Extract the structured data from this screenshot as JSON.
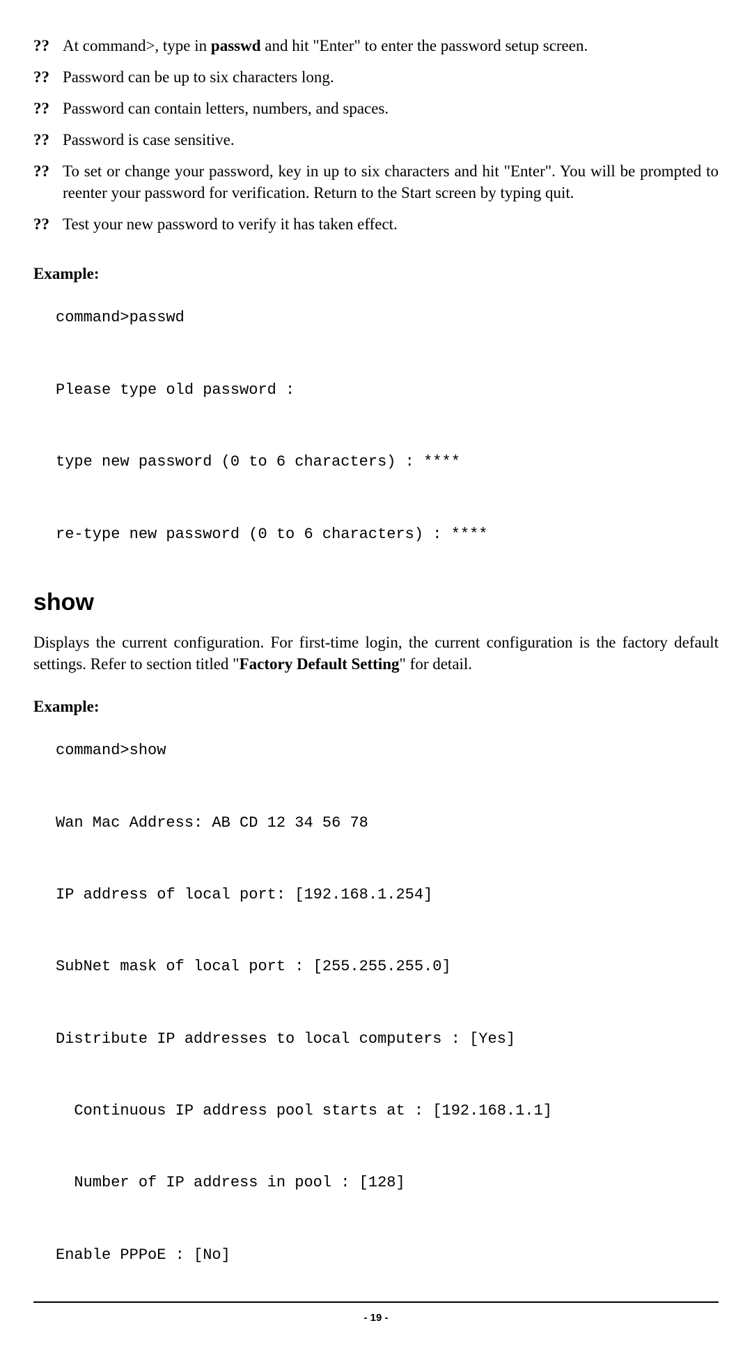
{
  "bullets": {
    "marker": "??",
    "items": [
      {
        "pre": "At command>, type in ",
        "bold": "passwd",
        "post": " and hit \"Enter\" to enter the password setup screen."
      },
      {
        "pre": "Password can be up to six characters long.",
        "bold": "",
        "post": ""
      },
      {
        "pre": "Password can contain letters, numbers, and spaces.",
        "bold": "",
        "post": ""
      },
      {
        "pre": "Password is case sensitive.",
        "bold": "",
        "post": ""
      },
      {
        "pre": "To set or change your password, key in up to six characters and hit \"Enter\". You will be prompted to reenter your password for verification. Return to the Start screen by typing quit.",
        "bold": "",
        "post": ""
      },
      {
        "pre": "Test your new password to verify it has taken effect.",
        "bold": "",
        "post": ""
      }
    ]
  },
  "example_label": "Example:",
  "example1_code": "command>passwd\n\nPlease type old password :\n\ntype new password (0 to 6 characters) : ****\n\nre-type new password (0 to 6 characters) : ****",
  "section_heading": "show",
  "show_para": {
    "pre": "Displays the current configuration. For first-time login, the current configuration is the factory default settings. Refer to section titled \"",
    "bold": "Factory Default Setting",
    "post": "\" for detail."
  },
  "example2_code": "command>show\n\nWan Mac Address: AB CD 12 34 56 78\n\nIP address of local port: [192.168.1.254]\n\nSubNet mask of local port : [255.255.255.0]\n\nDistribute IP addresses to local computers : [Yes]\n\n  Continuous IP address pool starts at : [192.168.1.1]\n\n  Number of IP address in pool : [128]\n\nEnable PPPoE : [No]",
  "page_number": "- 19 -"
}
